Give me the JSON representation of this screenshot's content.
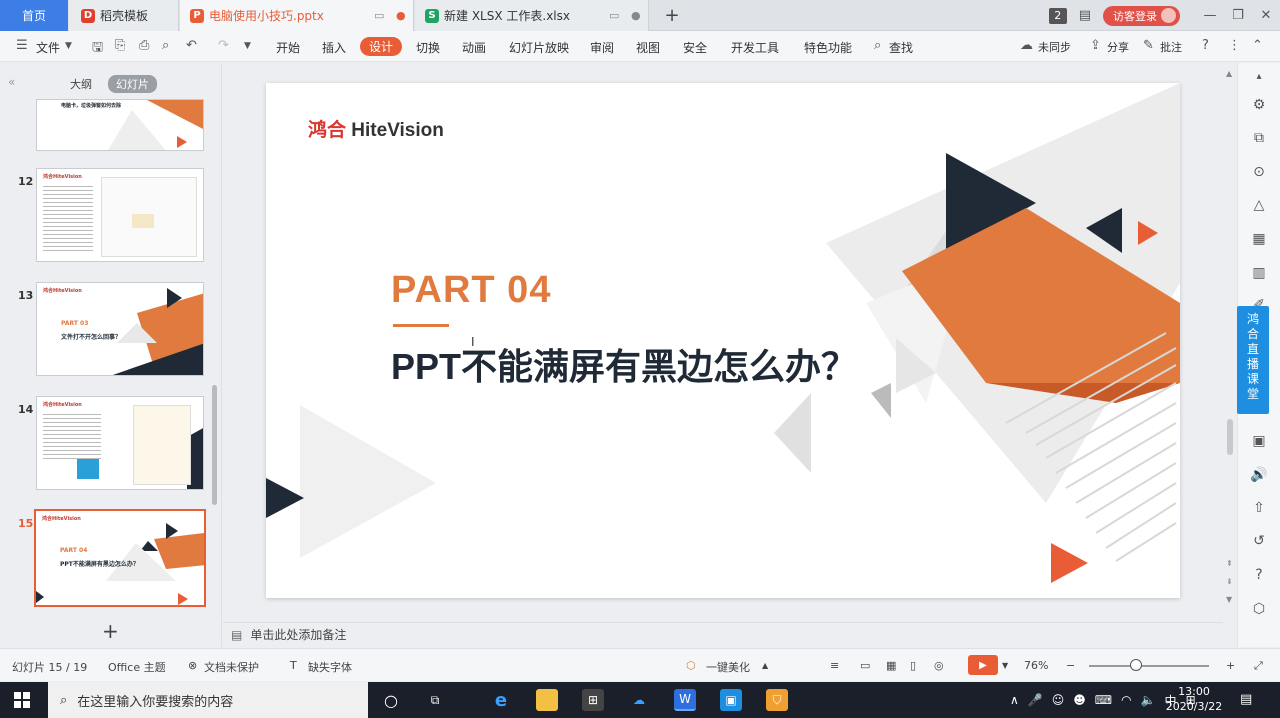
{
  "tabs": {
    "home": "首页",
    "template": "稻壳模板",
    "ppt_file": "电脑使用小技巧.pptx",
    "xlsx_file": "新建 XLSX 工作表.xlsx",
    "add": "+"
  },
  "header": {
    "window_count": "2",
    "login": "访客登录"
  },
  "menu": {
    "file": "文件",
    "items": [
      "开始",
      "插入",
      "设计",
      "切换",
      "动画",
      "幻灯片放映",
      "审阅",
      "视图",
      "安全",
      "开发工具",
      "特色功能"
    ],
    "active": "设计",
    "search": "查找",
    "sync": "未同步",
    "share": "分享",
    "comment": "批注"
  },
  "left_panel": {
    "outline_tab": "大纲",
    "slides_tab": "幻灯片",
    "add_slide": "+",
    "thumbs": [
      {
        "num": "",
        "title": "电脑卡，垃圾弹窗如何去除"
      },
      {
        "num": "12",
        "title": ""
      },
      {
        "num": "13",
        "part": "PART 03",
        "title": "文件打不开怎么回事？"
      },
      {
        "num": "14",
        "title": ""
      },
      {
        "num": "15",
        "part": "PART 04",
        "title": "PPT不能满屏有黑边怎么办？"
      }
    ]
  },
  "slide": {
    "logo_cn": "鸿合",
    "logo_en": "HiteVision",
    "part": "PART 04",
    "title": "PPT不能满屏有黑边怎么办？"
  },
  "notes_placeholder": "单击此处添加备注",
  "live_label": "鸿合直播课堂",
  "status": {
    "slide_counter": "幻灯片 15 / 19",
    "theme": "Office 主题",
    "protect": "文档未保护",
    "missing_font": "缺失字体",
    "beautify": "一键美化",
    "zoom": "76%"
  },
  "taskbar": {
    "search_placeholder": "在这里输入你要搜索的内容",
    "time": "13:00",
    "date": "2020/3/22",
    "ime": "中"
  },
  "colors": {
    "accent_orange": "#e07a3f",
    "active_orange": "#e85d36",
    "navy": "#1f2a36",
    "home_tab_blue": "#3d7ee6",
    "live_blue": "#1d8ee0"
  }
}
